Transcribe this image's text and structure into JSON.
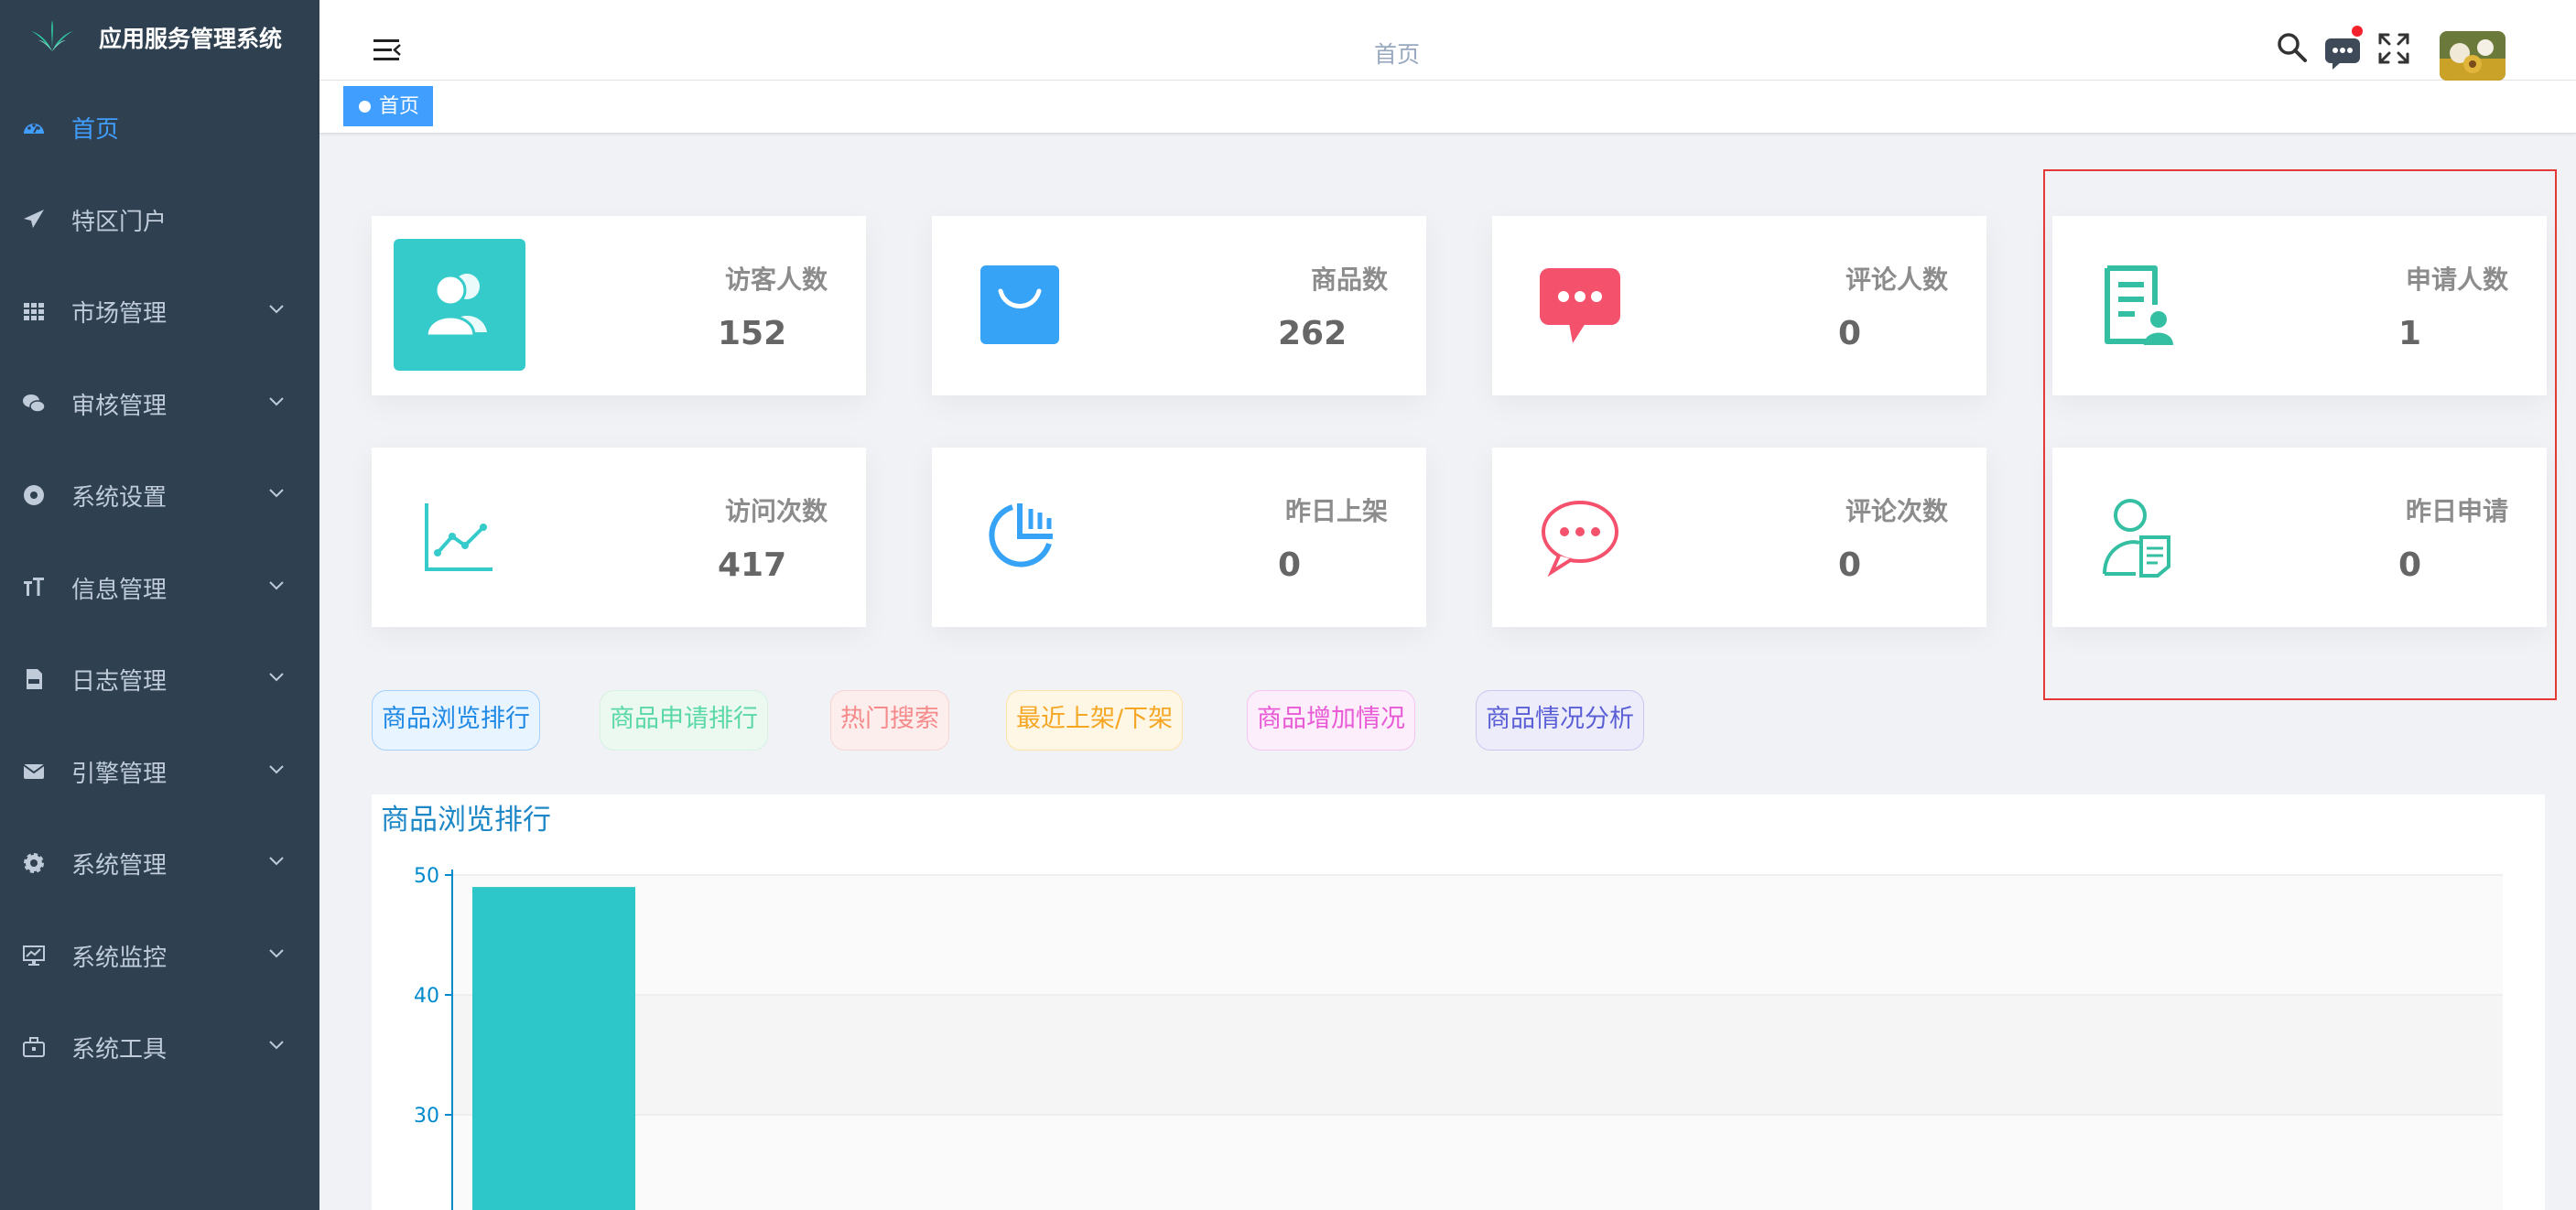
{
  "app": {
    "title": "应用服务管理系统"
  },
  "sidebar": {
    "items": [
      {
        "label": "首页",
        "icon": "dashboard-icon",
        "active": true,
        "expandable": false
      },
      {
        "label": "特区门户",
        "icon": "paper-plane-icon",
        "active": false,
        "expandable": false
      },
      {
        "label": "市场管理",
        "icon": "table-grid-icon",
        "active": false,
        "expandable": true
      },
      {
        "label": "审核管理",
        "icon": "wechat-icon",
        "active": false,
        "expandable": true
      },
      {
        "label": "系统设置",
        "icon": "compass-icon",
        "active": false,
        "expandable": true
      },
      {
        "label": "信息管理",
        "icon": "text-size-icon",
        "active": false,
        "expandable": true
      },
      {
        "label": "日志管理",
        "icon": "pdf-file-icon",
        "active": false,
        "expandable": true
      },
      {
        "label": "引擎管理",
        "icon": "envelope-icon",
        "active": false,
        "expandable": true
      },
      {
        "label": "系统管理",
        "icon": "gear-icon",
        "active": false,
        "expandable": true
      },
      {
        "label": "系统监控",
        "icon": "monitor-icon",
        "active": false,
        "expandable": true
      },
      {
        "label": "系统工具",
        "icon": "toolbox-icon",
        "active": false,
        "expandable": true
      }
    ]
  },
  "navbar": {
    "title": "首页"
  },
  "tags": [
    {
      "label": "首页",
      "active": true
    }
  ],
  "stats": [
    {
      "label": "访客人数",
      "value": "152",
      "icon": "users-icon",
      "color": "#36cbcb"
    },
    {
      "label": "商品数",
      "value": "262",
      "icon": "shopping-bag-icon",
      "color": "#36a3f7"
    },
    {
      "label": "评论人数",
      "value": "0",
      "icon": "chat-bubble-icon",
      "color": "#f4516c"
    },
    {
      "label": "申请人数",
      "value": "1",
      "icon": "application-doc-icon",
      "color": "#34bfa3"
    },
    {
      "label": "访问次数",
      "value": "417",
      "icon": "line-chart-icon",
      "color": "#36cbcb"
    },
    {
      "label": "昨日上架",
      "value": "0",
      "icon": "pie-chart-icon",
      "color": "#36a3f7"
    },
    {
      "label": "评论次数",
      "value": "0",
      "icon": "message-outline-icon",
      "color": "#f4516c"
    },
    {
      "label": "昨日申请",
      "value": "0",
      "icon": "user-doc-icon",
      "color": "#34bfa3"
    }
  ],
  "tabs": [
    {
      "label": "商品浏览排行",
      "color": "#1e88e5",
      "bg": "#e8f4ff",
      "border": "#a3d0fd"
    },
    {
      "label": "商品申请排行",
      "color": "#5ad8a6",
      "bg": "#ebf9f1",
      "border": "#d5f2e2"
    },
    {
      "label": "热门搜索",
      "color": "#f58a8a",
      "bg": "#fdeeee",
      "border": "#fad4d4"
    },
    {
      "label": "最近上架/下架",
      "color": "#f5a623",
      "bg": "#fff7e6",
      "border": "#ffe3a8"
    },
    {
      "label": "商品增加情况",
      "color": "#e85ad6",
      "bg": "#fdeefb",
      "border": "#f5c5ef"
    },
    {
      "label": "商品情况分析",
      "color": "#5b5fd6",
      "bg": "#ececfb",
      "border": "#c7c8f1"
    }
  ],
  "chart_data": {
    "type": "bar",
    "title": "商品浏览排行",
    "ylim": [
      20,
      50
    ],
    "yticks": [
      30,
      40,
      50
    ],
    "values": [
      49
    ],
    "color": "#2ec7c9",
    "axis_color": "#008acd",
    "grid": true
  }
}
